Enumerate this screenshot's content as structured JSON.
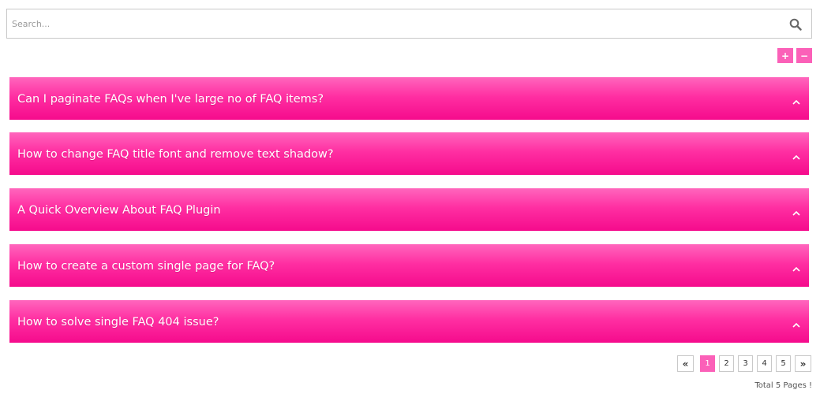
{
  "search": {
    "placeholder": "Search...",
    "icon": "search-icon"
  },
  "controls": {
    "expand_label": "+",
    "collapse_label": "−",
    "accent": "#fb60b8"
  },
  "faqs": [
    {
      "title": "Can I paginate FAQs when I've large no of FAQ items?",
      "icon": "chevron-up-icon"
    },
    {
      "title": "How to change FAQ title font and remove text shadow?",
      "icon": "chevron-up-icon"
    },
    {
      "title": "A Quick Overview About FAQ Plugin",
      "icon": "chevron-up-icon"
    },
    {
      "title": "How to create a custom single page for FAQ?",
      "icon": "chevron-up-icon"
    },
    {
      "title": "How to solve single FAQ 404 issue?",
      "icon": "chevron-up-icon"
    }
  ],
  "pagination": {
    "prev_label": "«",
    "next_label": "»",
    "pages": [
      "1",
      "2",
      "3",
      "4",
      "5"
    ],
    "current": "1",
    "total_text": "Total 5 Pages !"
  },
  "colors": {
    "faq_gradient_top": "#ff66bd",
    "faq_gradient_bottom": "#f50b8c"
  }
}
